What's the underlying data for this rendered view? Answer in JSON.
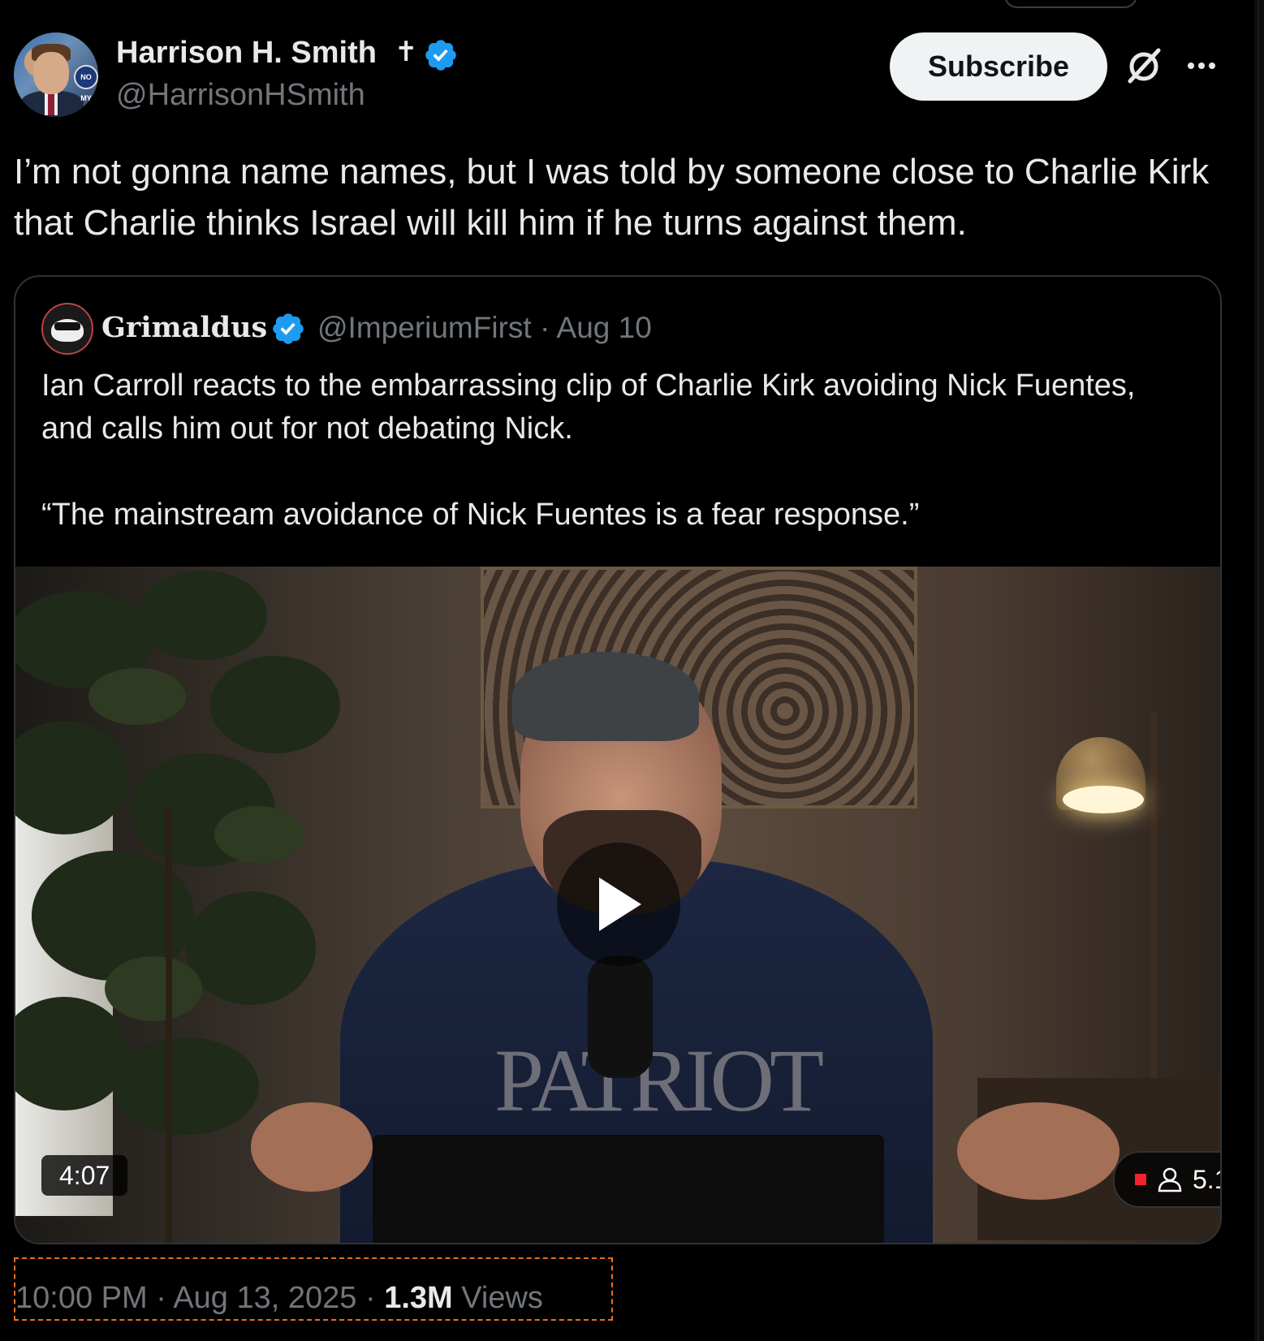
{
  "author": {
    "name": "Harrison H. Smith",
    "name_symbol": "✝",
    "handle": "@HarrisonHSmith",
    "avatar_badge": "NO MY"
  },
  "actions": {
    "subscribe_label": "Subscribe",
    "grok_icon": "grok-icon",
    "more_icon": "more-icon"
  },
  "tweet": {
    "text": "I’m not gonna name names, but I was told by someone close to Charlie Kirk that Charlie thinks Israel will kill him if he turns against them."
  },
  "quote": {
    "name": "Grimaldus",
    "handle_date": "@ImperiumFirst · Aug 10",
    "text": "Ian Carroll reacts to the embarrassing clip of Charlie Kirk avoiding Nick Fuentes, and calls him out for not debating Nick.\n\n“The mainstream avoidance of Nick Fuentes is a fear response.”",
    "video": {
      "duration": "4:07",
      "viewer_count": "5.1",
      "shirt_text": "PATRIOT"
    }
  },
  "meta": {
    "time_date": "10:00 PM · Aug 13, 2025 · ",
    "views_count": "1.3M",
    "views_label": " Views"
  },
  "colors": {
    "background": "#000000",
    "text": "#e7e9ea",
    "secondary": "#71767b",
    "verified": "#1d9bf0",
    "border": "#2f3336",
    "highlight_box": "#e56f20",
    "live": "#f4212e"
  }
}
